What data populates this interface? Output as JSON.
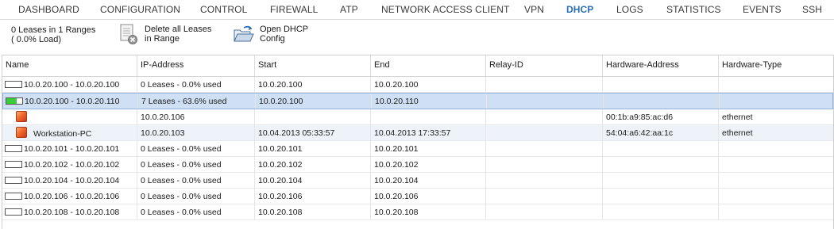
{
  "nav": [
    {
      "label": "DASHBOARD",
      "active": false
    },
    {
      "label": "CONFIGURATION",
      "active": false
    },
    {
      "label": "CONTROL",
      "active": false
    },
    {
      "label": "FIREWALL",
      "active": false
    },
    {
      "label": "ATP",
      "active": false
    },
    {
      "label": "NETWORK ACCESS CLIENT",
      "active": false
    },
    {
      "label": "VPN",
      "active": false
    },
    {
      "label": "DHCP",
      "active": true
    },
    {
      "label": "LOGS",
      "active": false
    },
    {
      "label": "STATISTICS",
      "active": false
    },
    {
      "label": "EVENTS",
      "active": false
    },
    {
      "label": "SSH",
      "active": false
    }
  ],
  "toolbar": {
    "summary_line1": "0 Leases in 1 Ranges",
    "summary_line2": "( 0.0% Load)",
    "delete_line1": "Delete all Leases",
    "delete_line2": "in Range",
    "open_line1": "Open DHCP",
    "open_line2": "Config"
  },
  "columns": [
    "Name",
    "IP-Address",
    "Start",
    "End",
    "Relay-ID",
    "Hardware-Address",
    "Hardware-Type"
  ],
  "rows": [
    {
      "type": "range",
      "usage": 0.0,
      "name": "10.0.20.100 - 10.0.20.100",
      "ip": "0 Leases -  0.0% used",
      "start": "10.0.20.100",
      "end": "10.0.20.100",
      "relay": "",
      "hw": "",
      "hwtype": ""
    },
    {
      "type": "range",
      "usage": 0.636,
      "selected": true,
      "name": "10.0.20.100 - 10.0.20.110",
      "ip": "7 Leases - 63.6% used",
      "start": "10.0.20.100",
      "end": "10.0.20.110",
      "relay": "",
      "hw": "",
      "hwtype": ""
    },
    {
      "type": "lease",
      "name": "",
      "ip": "10.0.20.106",
      "start": "",
      "end": "",
      "relay": "",
      "hw": "00:1b:a9:85:ac:d6",
      "hwtype": "ethernet"
    },
    {
      "type": "lease",
      "alt": true,
      "name": "Workstation-PC",
      "ip": "10.0.20.103",
      "start": "10.04.2013 05:33:57",
      "end": "10.04.2013 17:33:57",
      "relay": "",
      "hw": "54:04:a6:42:aa:1c",
      "hwtype": "ethernet"
    },
    {
      "type": "range",
      "usage": 0.0,
      "name": "10.0.20.101 - 10.0.20.101",
      "ip": "0 Leases -  0.0% used",
      "start": "10.0.20.101",
      "end": "10.0.20.101",
      "relay": "",
      "hw": "",
      "hwtype": ""
    },
    {
      "type": "range",
      "usage": 0.0,
      "name": "10.0.20.102 - 10.0.20.102",
      "ip": "0 Leases -  0.0% used",
      "start": "10.0.20.102",
      "end": "10.0.20.102",
      "relay": "",
      "hw": "",
      "hwtype": ""
    },
    {
      "type": "range",
      "usage": 0.0,
      "name": "10.0.20.104 - 10.0.20.104",
      "ip": "0 Leases -  0.0% used",
      "start": "10.0.20.104",
      "end": "10.0.20.104",
      "relay": "",
      "hw": "",
      "hwtype": ""
    },
    {
      "type": "range",
      "usage": 0.0,
      "name": "10.0.20.106 - 10.0.20.106",
      "ip": "0 Leases -  0.0% used",
      "start": "10.0.20.106",
      "end": "10.0.20.106",
      "relay": "",
      "hw": "",
      "hwtype": ""
    },
    {
      "type": "range",
      "usage": 0.0,
      "name": "10.0.20.108 - 10.0.20.108",
      "ip": "0 Leases -  0.0% used",
      "start": "10.0.20.108",
      "end": "10.0.20.108",
      "relay": "",
      "hw": "",
      "hwtype": ""
    }
  ],
  "colors": {
    "active_tab": "#2a6ebb",
    "selected_row": "#cfe0f4",
    "usage_bar": "#3bcc3b",
    "lease_icon": "#f06a2a"
  },
  "icons": {
    "delete": "delete-leases-icon",
    "open": "open-folder-icon",
    "range": "range-usage-icon",
    "lease": "lease-host-icon"
  }
}
